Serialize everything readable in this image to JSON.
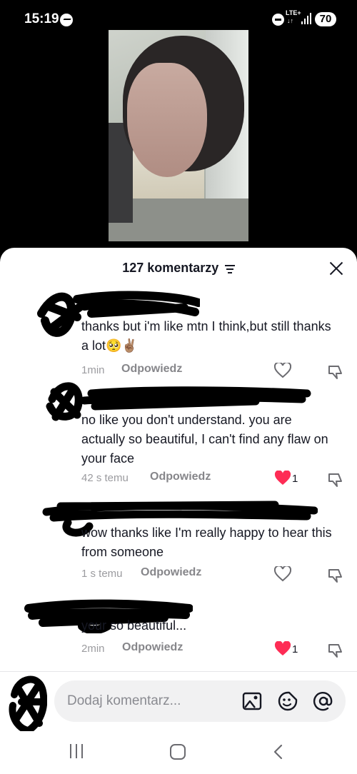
{
  "status_bar": {
    "time": "15:19",
    "network": "LTE+",
    "network_arrows": "↓↑",
    "battery": "70"
  },
  "sheet": {
    "comment_count": "127 komentarzy"
  },
  "comments": [
    {
      "text": "thanks but i'm like mtn I think,but still thanks a lot🥺✌🏽",
      "time": "1min",
      "reply_label": "Odpowiedz",
      "liked": false,
      "like_count": ""
    },
    {
      "text": "no like you don't understand. you are actually so beautiful, I can't find any flaw on your face",
      "time": "42 s temu",
      "reply_label": "Odpowiedz",
      "liked": true,
      "like_count": "1"
    },
    {
      "text": "wow thanks like I'm really happy to hear this from someone",
      "time": "1 s temu",
      "reply_label": "Odpowiedz",
      "liked": false,
      "like_count": ""
    },
    {
      "text": "your so beautiful...",
      "time": "2min",
      "reply_label": "Odpowiedz",
      "liked": true,
      "like_count": "1"
    }
  ],
  "input_bar": {
    "placeholder": "Dodaj komentarz..."
  },
  "colors": {
    "like_red": "#fe2c55",
    "text": "#161823",
    "muted": "#9b9b9f"
  },
  "icons": [
    "messenger-icon",
    "dnd-icon",
    "signal-icon",
    "filter-icon",
    "close-icon",
    "heart-icon",
    "dislike-icon",
    "image-icon",
    "emoji-icon",
    "mention-icon",
    "nav-recents-icon",
    "nav-home-icon",
    "nav-back-icon"
  ]
}
